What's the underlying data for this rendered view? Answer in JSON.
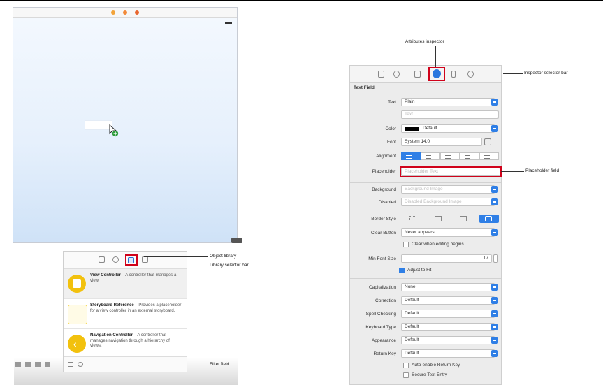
{
  "canvas": {
    "title_dots": [
      "#f2a33a",
      "#f2a33a",
      "#f2a33a"
    ]
  },
  "library": {
    "items": [
      {
        "title": "View Controller",
        "description": "A controller that manages a view."
      },
      {
        "title": "Storyboard Reference",
        "description": "Provides a placeholder for a view controller in an external storyboard."
      },
      {
        "title": "Navigation Controller",
        "description": "A controller that manages navigation through a hierarchy of views."
      }
    ]
  },
  "inspector": {
    "section_title": "Text Field",
    "rows": {
      "text": {
        "label": "Text",
        "value": "Plain",
        "sub_value": "Text"
      },
      "color": {
        "label": "Color",
        "value": "Default"
      },
      "font": {
        "label": "Font",
        "value": "System 14.0"
      },
      "alignment": {
        "label": "Alignment"
      },
      "placeholder": {
        "label": "Placeholder",
        "value": "Placeholder Text"
      },
      "background": {
        "label": "Background",
        "value": "Background Image"
      },
      "disabled": {
        "label": "Disabled",
        "value": "Disabled Background Image"
      },
      "border_style": {
        "label": "Border Style"
      },
      "clear_button": {
        "label": "Clear Button",
        "value": "Never appears"
      },
      "clear_when_editing": {
        "label": "Clear when editing begins"
      },
      "min_font_size": {
        "label": "Min Font Size",
        "value": "17"
      },
      "adjust_to_fit": {
        "label": "Adjust to Fit"
      },
      "capitalization": {
        "label": "Capitalization",
        "value": "None"
      },
      "correction": {
        "label": "Correction",
        "value": "Default"
      },
      "spell_checking": {
        "label": "Spell Checking",
        "value": "Default"
      },
      "keyboard_type": {
        "label": "Keyboard Type",
        "value": "Default"
      },
      "appearance": {
        "label": "Appearance",
        "value": "Default"
      },
      "return_key": {
        "label": "Return Key",
        "value": "Default"
      },
      "auto_enable_return": {
        "label": "Auto-enable Return Key"
      },
      "secure_text": {
        "label": "Secure Text Entry"
      }
    }
  },
  "callouts": {
    "attributes_inspector": "Attributes inspector",
    "inspector_selector_bar": "Inspector selector bar",
    "placeholder_field": "Placeholder field",
    "object_library": "Object library",
    "library_selector_bar": "Library selector bar",
    "filter_field": "Filter field"
  },
  "colors": {
    "highlight": "#d0021b",
    "accent_blue": "#2f7fe6",
    "library_yellow": "#f2c10d"
  }
}
